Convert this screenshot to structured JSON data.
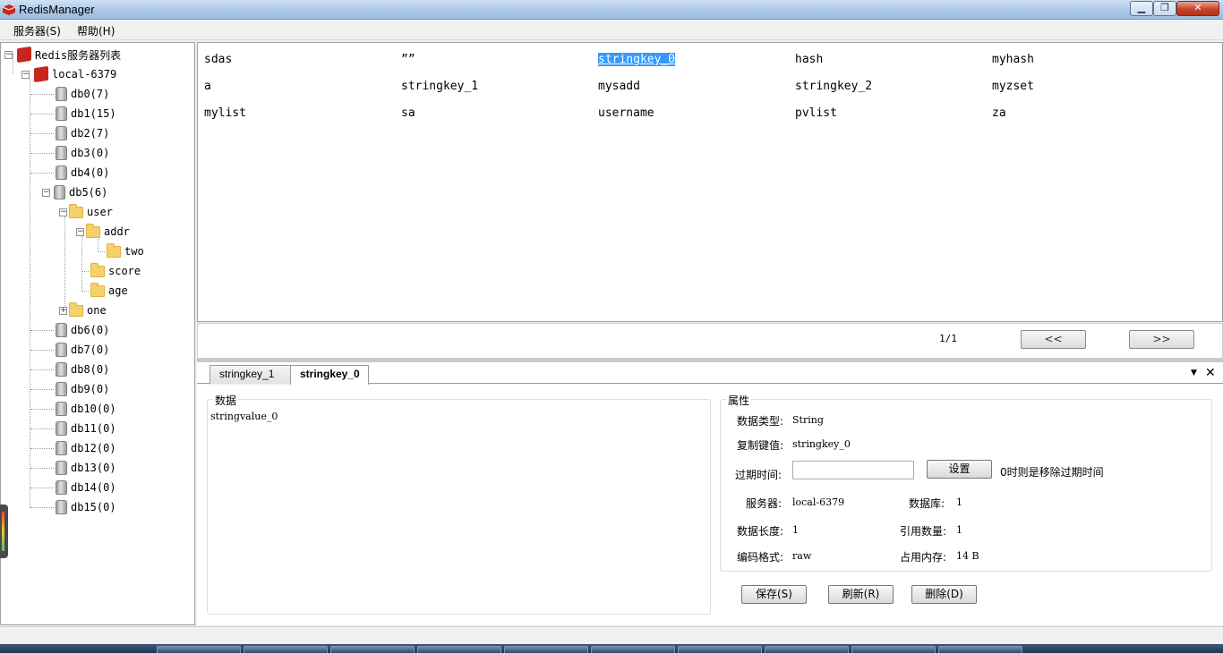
{
  "window": {
    "title": "RedisManager",
    "min_icon": "minimize-icon",
    "max_icon": "maximize-icon",
    "close_icon": "close-icon"
  },
  "menu": {
    "items": [
      {
        "label": "服务器(S)"
      },
      {
        "label": "帮助(H)"
      }
    ]
  },
  "tree": {
    "root_label": "Redis服务器列表",
    "server_label": "local-6379",
    "databases": [
      {
        "label": "db0(7)"
      },
      {
        "label": "db1(15)"
      },
      {
        "label": "db2(7)"
      },
      {
        "label": "db3(0)"
      },
      {
        "label": "db4(0)"
      },
      {
        "label": "db5(6)"
      },
      {
        "label": "db6(0)"
      },
      {
        "label": "db7(0)"
      },
      {
        "label": "db8(0)"
      },
      {
        "label": "db9(0)"
      },
      {
        "label": "db10(0)"
      },
      {
        "label": "db11(0)"
      },
      {
        "label": "db12(0)"
      },
      {
        "label": "db13(0)"
      },
      {
        "label": "db14(0)"
      },
      {
        "label": "db15(0)"
      }
    ],
    "folders": {
      "user": "user",
      "addr": "addr",
      "two": "two",
      "score": "score",
      "age": "age",
      "one": "one"
    }
  },
  "keys": {
    "rows": [
      [
        "sdas",
        "””",
        "stringkey_0",
        "hash",
        "myhash"
      ],
      [
        "a",
        "stringkey_1",
        "mysadd",
        "stringkey_2",
        "myzset"
      ],
      [
        "mylist",
        "sa",
        "username",
        "pvlist",
        "za"
      ]
    ],
    "selected": "stringkey_0"
  },
  "pager": {
    "info": "1/1",
    "prev_label": "<<",
    "next_label": ">>"
  },
  "tabs": [
    {
      "label": "stringkey_1"
    },
    {
      "label": "stringkey_0"
    }
  ],
  "data_panel": {
    "legend": "数据",
    "value": "stringvalue_0"
  },
  "props": {
    "legend": "属性",
    "type_label": "数据类型:",
    "type_value": "String",
    "copy_label": "复制键值:",
    "copy_value": "stringkey_0",
    "expire_label": "过期时间:",
    "expire_value": "",
    "set_button": "设置",
    "expire_hint": "0时则是移除过期时间",
    "server_label": "服务器:",
    "server_value": "local-6379",
    "db_label": "数据库:",
    "db_value": "1",
    "length_label": "数据长度:",
    "length_value": "1",
    "refcount_label": "引用数量:",
    "refcount_value": "1",
    "encoding_label": "编码格式:",
    "encoding_value": "raw",
    "memory_label": "占用内存:",
    "memory_value": "14 B"
  },
  "actions": {
    "save": "保存(S)",
    "refresh": "刷新(R)",
    "delete": "删除(D)"
  }
}
